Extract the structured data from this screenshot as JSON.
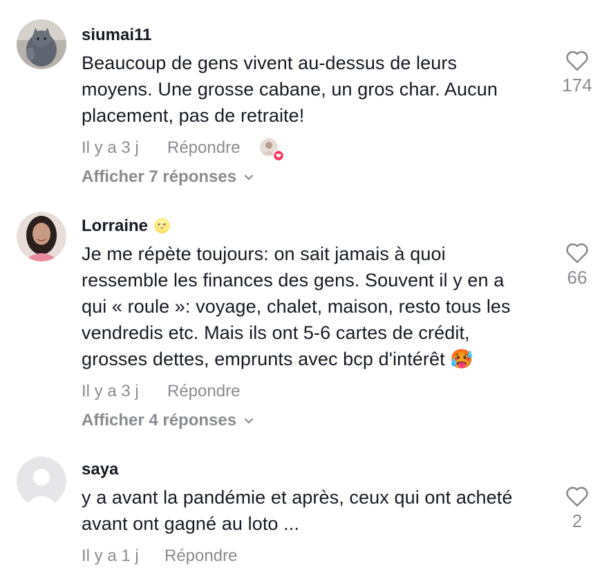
{
  "comments": [
    {
      "username": "siumai11",
      "text_lines": [
        "Beaucoup de gens vivent au-dessus de leurs",
        "moyens. Une grosse cabane, un gros char. Aucun",
        "placement, pas de retraite!"
      ],
      "time": "Il y a 3 j",
      "reply_label": "Répondre",
      "creator_liked": true,
      "view_replies": "Afficher 7 réponses",
      "likes": "174",
      "avatar_icon": "cat-photo"
    },
    {
      "username": "Lorraine",
      "username_emoji": "🌝",
      "text_lines": [
        "Je me répète toujours: on sait jamais à quoi",
        "ressemble les finances des gens. Souvent il y en a",
        "qui « roule »: voyage, chalet, maison, resto tous les",
        "vendredis etc. Mais ils ont 5-6 cartes de crédit,",
        "grosses dettes, emprunts avec bcp d'intérêt 🥵"
      ],
      "time": "Il y a 3 j",
      "reply_label": "Répondre",
      "view_replies": "Afficher 4 réponses",
      "likes": "66",
      "avatar_icon": "woman-photo"
    },
    {
      "username": "saya",
      "text_lines": [
        "y a avant la pandémie et après, ceux qui ont acheté",
        "avant ont gagné au loto ..."
      ],
      "time": "Il y a 1 j",
      "reply_label": "Répondre",
      "likes": "2",
      "avatar_icon": "default-avatar"
    }
  ],
  "colors": {
    "text": "#161823",
    "secondary": "#8a8b91",
    "heart_badge": "#fe2c55"
  }
}
